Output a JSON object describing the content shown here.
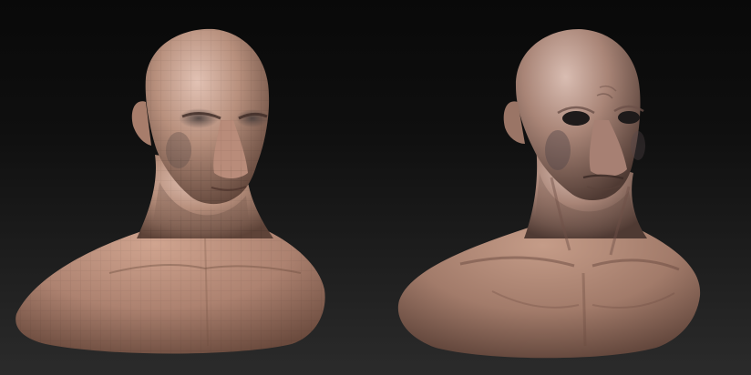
{
  "scene": {
    "background_top": "#090909",
    "background_bottom": "#2b2b2b",
    "models": [
      {
        "name": "low-poly-bust",
        "variant": "faceted",
        "skin_color": "#b38a76"
      },
      {
        "name": "sculpted-bust",
        "variant": "detailed",
        "skin_color": "#a88273"
      }
    ]
  }
}
